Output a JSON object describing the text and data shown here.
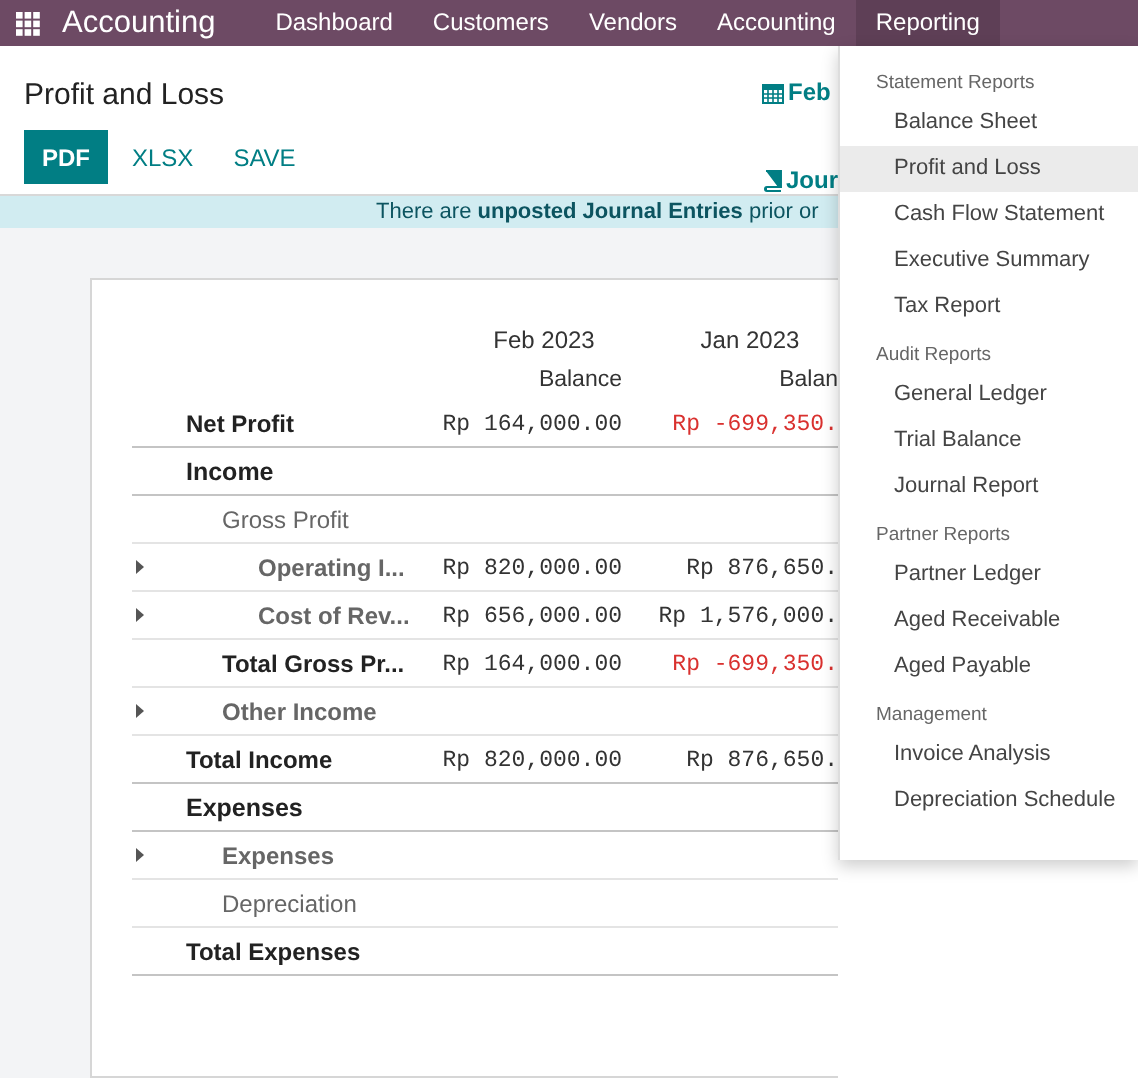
{
  "navbar": {
    "app_name": "Accounting",
    "items": [
      {
        "label": "Dashboard",
        "selected": false
      },
      {
        "label": "Customers",
        "selected": false
      },
      {
        "label": "Vendors",
        "selected": false
      },
      {
        "label": "Accounting",
        "selected": false
      },
      {
        "label": "Reporting",
        "selected": true
      }
    ]
  },
  "page": {
    "title": "Profit and Loss",
    "buttons": [
      {
        "label": "PDF",
        "kind": "primary"
      },
      {
        "label": "XLSX",
        "kind": "link"
      },
      {
        "label": "SAVE",
        "kind": "link"
      }
    ],
    "filters": [
      {
        "label": "Feb",
        "kind": "date"
      },
      {
        "label": "Jour",
        "kind": "journal"
      }
    ]
  },
  "banner": {
    "text": "There are **unposted Journal Entries** prior or"
  },
  "report": {
    "columns": [
      {
        "period": "Feb 2023",
        "label": "Balance"
      },
      {
        "period": "Jan 2023",
        "label": "Balan"
      }
    ],
    "lines": [
      {
        "label": "Net Profit",
        "kind": "total",
        "bold": true,
        "expandable": false,
        "values": [
          {
            "text": "Rp 164,000.00",
            "negative": false
          },
          {
            "text": "Rp -699,350.",
            "negative": true
          }
        ]
      },
      {
        "label": "Income",
        "kind": "section",
        "bold": true,
        "expandable": false,
        "children": [
          {
            "label": "Gross Profit",
            "kind": "line",
            "bold": false,
            "expandable": false,
            "children": [
              {
                "label": "Operating I...",
                "kind": "line",
                "bold": true,
                "expandable": true,
                "values": [
                  {
                    "text": "Rp 820,000.00",
                    "negative": false
                  },
                  {
                    "text": "Rp 876,650.",
                    "negative": false
                  }
                ]
              },
              {
                "label": "Cost of Rev...",
                "kind": "line",
                "bold": true,
                "expandable": true,
                "values": [
                  {
                    "text": "Rp 656,000.00",
                    "negative": false
                  },
                  {
                    "text": "Rp 1,576,000.",
                    "negative": false
                  }
                ]
              }
            ]
          },
          {
            "label": "Total Gross Pr...",
            "kind": "total",
            "bold": true,
            "expandable": false,
            "values": [
              {
                "text": "Rp 164,000.00",
                "negative": false
              },
              {
                "text": "Rp -699,350.",
                "negative": true
              }
            ]
          },
          {
            "label": "Other Income",
            "kind": "line",
            "bold": true,
            "expandable": true
          }
        ]
      },
      {
        "label": "Total Income",
        "kind": "total",
        "bold": true,
        "expandable": false,
        "values": [
          {
            "text": "Rp 820,000.00",
            "negative": false
          },
          {
            "text": "Rp 876,650.",
            "negative": false
          }
        ]
      },
      {
        "label": "Expenses",
        "kind": "section",
        "bold": true,
        "expandable": false,
        "children": [
          {
            "label": "Expenses",
            "kind": "line",
            "bold": true,
            "expandable": true
          },
          {
            "label": "Depreciation",
            "kind": "line",
            "bold": false,
            "expandable": false
          }
        ]
      },
      {
        "label": "Total Expenses",
        "kind": "total",
        "bold": true,
        "expandable": false
      }
    ]
  },
  "menu": {
    "groups": [
      {
        "header": "Statement Reports",
        "items": [
          {
            "label": "Balance Sheet",
            "selected": false
          },
          {
            "label": "Profit and Loss",
            "selected": true
          },
          {
            "label": "Cash Flow Statement",
            "selected": false
          },
          {
            "label": "Executive Summary",
            "selected": false
          },
          {
            "label": "Tax Report",
            "selected": false
          }
        ]
      },
      {
        "header": "Audit Reports",
        "items": [
          {
            "label": "General Ledger",
            "selected": false
          },
          {
            "label": "Trial Balance",
            "selected": false
          },
          {
            "label": "Journal Report",
            "selected": false
          }
        ]
      },
      {
        "header": "Partner Reports",
        "items": [
          {
            "label": "Partner Ledger",
            "selected": false
          },
          {
            "label": "Aged Receivable",
            "selected": false
          },
          {
            "label": "Aged Payable",
            "selected": false
          }
        ]
      },
      {
        "header": "Management",
        "items": [
          {
            "label": "Invoice Analysis",
            "selected": false
          },
          {
            "label": "Depreciation Schedule",
            "selected": false
          }
        ]
      }
    ]
  }
}
